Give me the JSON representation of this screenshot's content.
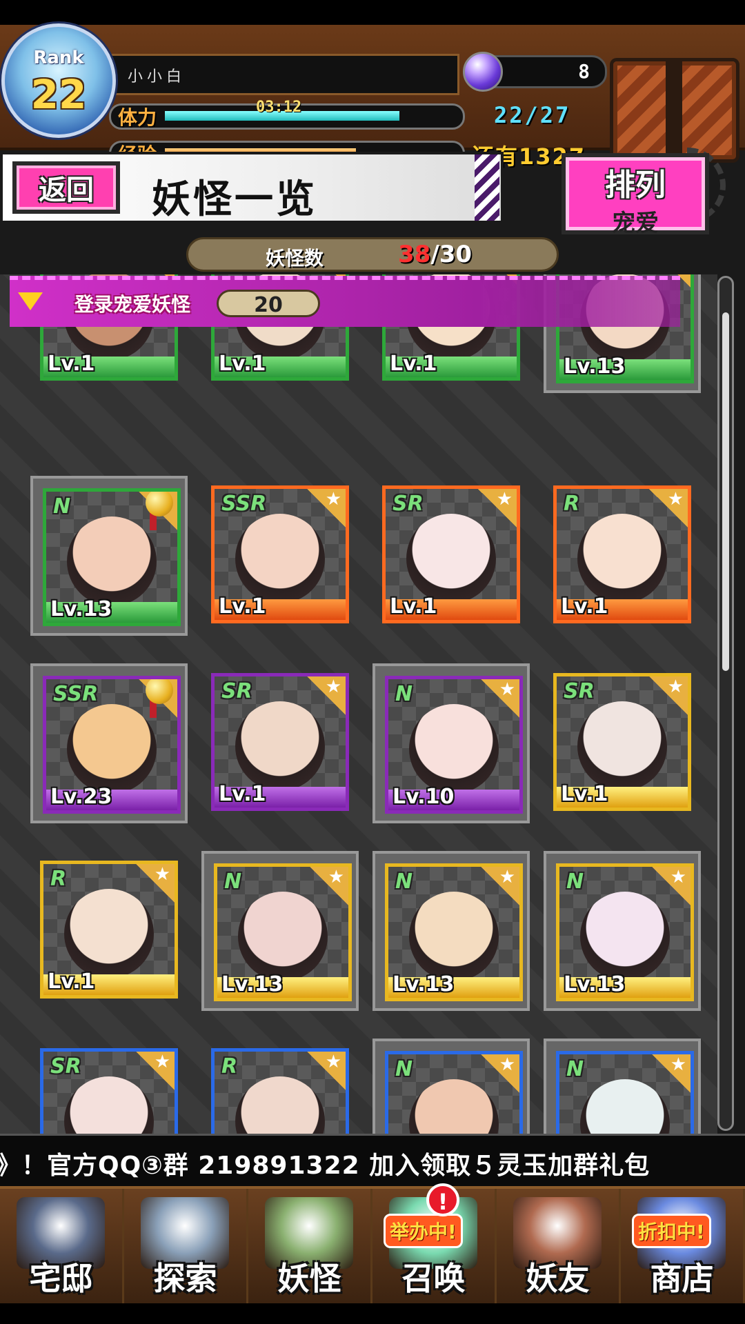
{
  "header": {
    "rank_label": "Rank",
    "rank_value": "22",
    "player_name": "小小白",
    "gem_count": "8",
    "stamina_label": "体力",
    "stamina_timer": "03:12",
    "stamina_value": "22/27",
    "stamina_fraction": 0.81,
    "exp_label": "经验",
    "exp_remaining": "还有1327",
    "exp_fraction": 0.66
  },
  "title_bar": {
    "back_label": "返回",
    "title": "妖怪一览",
    "sort_title": "排列",
    "sort_value": "宠爱"
  },
  "count_bar": {
    "label": "妖怪数",
    "current": "38",
    "max": "/30"
  },
  "favorites": {
    "label": "登录宠爱妖怪",
    "count": "20"
  },
  "monsters": [
    {
      "rarity": "",
      "level": "Lv.1",
      "frame": "green",
      "selected": false,
      "medal": false,
      "face": "#c89070"
    },
    {
      "rarity": "",
      "level": "Lv.1",
      "frame": "green",
      "selected": false,
      "medal": false,
      "face": "#f0dcc8"
    },
    {
      "rarity": "",
      "level": "Lv.1",
      "frame": "green",
      "selected": false,
      "medal": false,
      "face": "#f6e0c8"
    },
    {
      "rarity": "",
      "level": "Lv.13",
      "frame": "green",
      "selected": true,
      "medal": false,
      "face": "#f3d9c4"
    },
    {
      "rarity": "N",
      "level": "Lv.13",
      "frame": "green",
      "selected": true,
      "medal": true,
      "face": "#f3cdb8"
    },
    {
      "rarity": "SSR",
      "level": "Lv.1",
      "frame": "orange",
      "selected": false,
      "medal": false,
      "face": "#f4d4c4"
    },
    {
      "rarity": "SR",
      "level": "Lv.1",
      "frame": "orange",
      "selected": false,
      "medal": false,
      "face": "#f8e6e6"
    },
    {
      "rarity": "R",
      "level": "Lv.1",
      "frame": "orange",
      "selected": false,
      "medal": false,
      "face": "#f8e0d0"
    },
    {
      "rarity": "SSR",
      "level": "Lv.23",
      "frame": "purple",
      "selected": true,
      "medal": true,
      "face": "#f4c890"
    },
    {
      "rarity": "SR",
      "level": "Lv.1",
      "frame": "purple",
      "selected": false,
      "medal": false,
      "face": "#f0d8c8"
    },
    {
      "rarity": "N",
      "level": "Lv.10",
      "frame": "purple",
      "selected": true,
      "medal": false,
      "face": "#f8e0dc"
    },
    {
      "rarity": "SR",
      "level": "Lv.1",
      "frame": "gold",
      "selected": false,
      "medal": false,
      "face": "#f0e4e0"
    },
    {
      "rarity": "R",
      "level": "Lv.1",
      "frame": "gold",
      "selected": false,
      "medal": false,
      "face": "#f4e0d0"
    },
    {
      "rarity": "N",
      "level": "Lv.13",
      "frame": "gold",
      "selected": true,
      "medal": false,
      "face": "#f0d4d0"
    },
    {
      "rarity": "N",
      "level": "Lv.13",
      "frame": "gold",
      "selected": true,
      "medal": false,
      "face": "#f4dcc0"
    },
    {
      "rarity": "N",
      "level": "Lv.13",
      "frame": "gold",
      "selected": true,
      "medal": false,
      "face": "#f4e4f0"
    },
    {
      "rarity": "SR",
      "level": "",
      "frame": "blue",
      "selected": false,
      "medal": false,
      "face": "#f4e0dc"
    },
    {
      "rarity": "R",
      "level": "",
      "frame": "blue",
      "selected": false,
      "medal": false,
      "face": "#f0d8cc"
    },
    {
      "rarity": "N",
      "level": "",
      "frame": "blue",
      "selected": true,
      "medal": false,
      "face": "#f0c8b0"
    },
    {
      "rarity": "N",
      "level": "",
      "frame": "blue",
      "selected": true,
      "medal": false,
      "face": "#e8f0f0"
    }
  ],
  "ticker": {
    "text": "》！官方QQ③群 219891322   加入领取５灵玉加群礼包"
  },
  "bottom_nav": [
    {
      "label": "宅邸",
      "icon": "mansion-icon",
      "art": "#5a6a8a",
      "badge": ""
    },
    {
      "label": "探索",
      "icon": "magnifier-icon",
      "art": "#8aa0b8",
      "badge": ""
    },
    {
      "label": "妖怪",
      "icon": "scroll-icon",
      "art": "#8ab070",
      "badge": ""
    },
    {
      "label": "召唤",
      "icon": "star-icon",
      "art": "#7adab0",
      "badge": "举办中!"
    },
    {
      "label": "妖友",
      "icon": "fox-girl-icon",
      "art": "#b06a50",
      "badge": ""
    },
    {
      "label": "商店",
      "icon": "crystal-ball-icon",
      "art": "#6a8ae0",
      "badge": "折扣中!"
    }
  ],
  "alert_icon": "!"
}
